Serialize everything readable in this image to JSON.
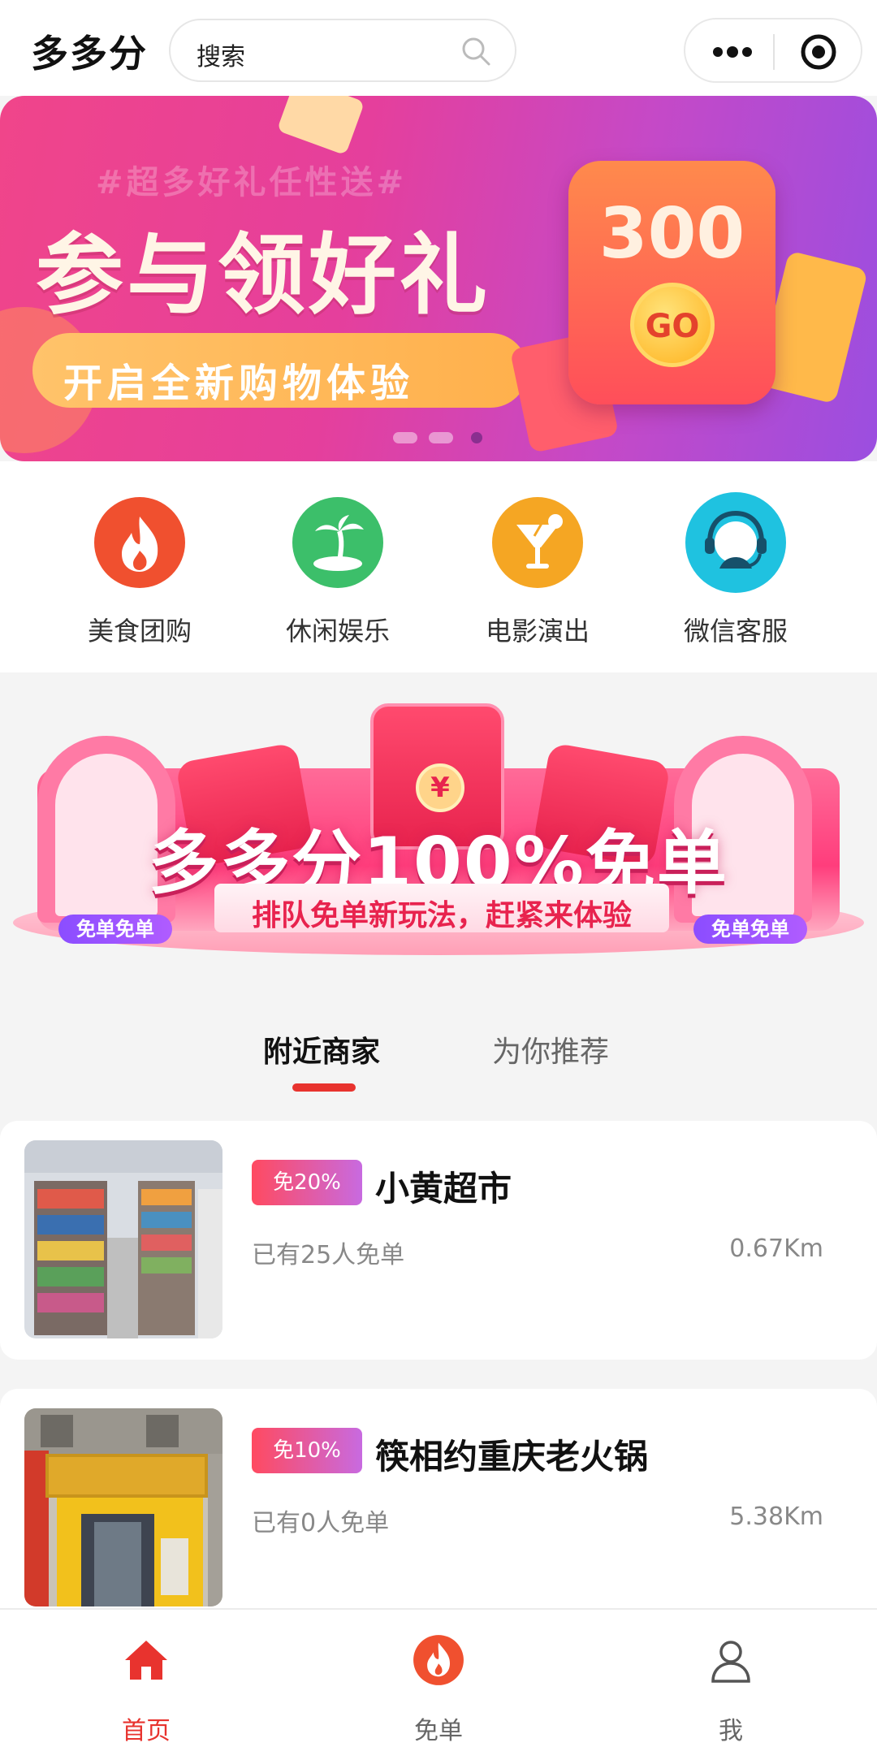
{
  "header": {
    "app_title": "多多分",
    "search_placeholder": "搜索"
  },
  "hero_banner": {
    "tagline": "#超多好礼任性送#",
    "headline": "参与领好礼",
    "subline": "开启全新购物体验",
    "card_amount": "300",
    "card_button": "GO",
    "slides_total": 3,
    "slide_active": 3
  },
  "categories": [
    {
      "label": "美食团购",
      "icon": "fire-icon",
      "color": "#f0502f"
    },
    {
      "label": "休闲娱乐",
      "icon": "palm-tree-icon",
      "color": "#3cbf6a"
    },
    {
      "label": "电影演出",
      "icon": "cocktail-icon",
      "color": "#f5a623"
    },
    {
      "label": "微信客服",
      "icon": "headset-icon",
      "color": "#1fc2e0"
    }
  ],
  "promo_banner": {
    "title": "多多分100%免单",
    "subtitle": "排队免单新玩法，赶紧来体验",
    "badge_left": "免单免单",
    "badge_right": "免单免单",
    "coin_symbol": "¥"
  },
  "tabs": {
    "nearby": "附近商家",
    "recommended": "为你推荐",
    "active": "nearby"
  },
  "stores": [
    {
      "discount": "免20%",
      "name": "小黄超市",
      "count_text": "已有25人免单",
      "distance": "0.67Km"
    },
    {
      "discount": "免10%",
      "name": "筷相约重庆老火锅",
      "count_text": "已有0人免单",
      "distance": "5.38Km"
    }
  ],
  "tabbar": {
    "home": "首页",
    "free": "免单",
    "me": "我",
    "active": "home"
  },
  "colors": {
    "accent": "#e8332e",
    "tab_inactive": "#666666"
  }
}
